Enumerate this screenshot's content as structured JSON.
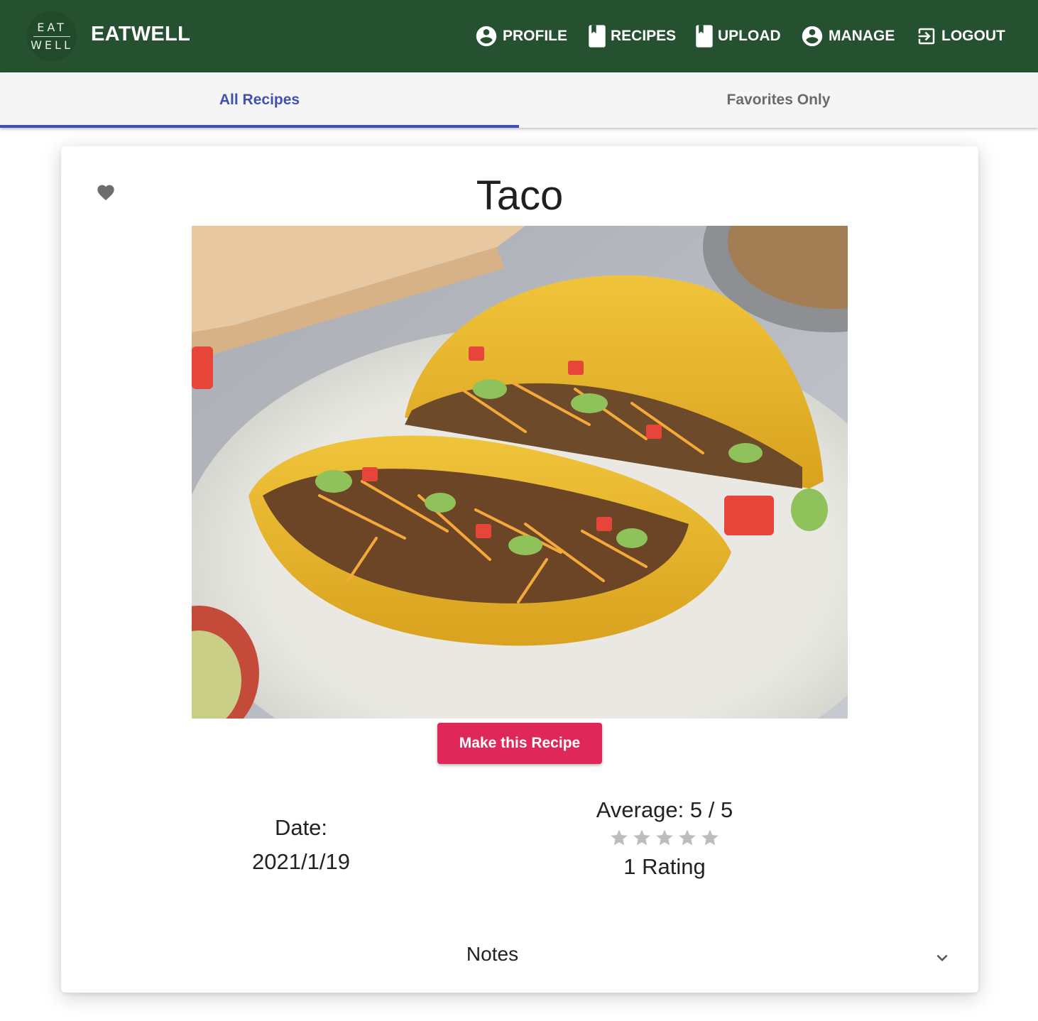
{
  "appbar": {
    "logo_top": "EAT",
    "logo_bottom": "WELL",
    "brand": "EATWELL",
    "nav": {
      "profile": "PROFILE",
      "recipes": "RECIPES",
      "upload": "UPLOAD",
      "manage": "MANAGE",
      "logout": "LOGOUT"
    },
    "icons": {
      "profile": "account-circle-icon",
      "recipes": "book-icon",
      "upload": "book-icon",
      "manage": "account-circle-icon",
      "logout": "logout-icon"
    },
    "color": "#255130"
  },
  "tabs": {
    "all": "All Recipes",
    "favorites": "Favorites Only",
    "active": "All Recipes",
    "accent": "#3f51b5"
  },
  "recipe": {
    "title": "Taco",
    "favorite_icon": "heart-icon",
    "make_button": "Make this Recipe",
    "make_button_color": "#e0275a",
    "date_label": "Date:",
    "date_value": "2021/1/19",
    "average_label": "Average: 5 / 5",
    "stars_total": 5,
    "rating_count": "1 Rating",
    "notes_label": "Notes",
    "notes_icon": "chevron-down-icon"
  }
}
